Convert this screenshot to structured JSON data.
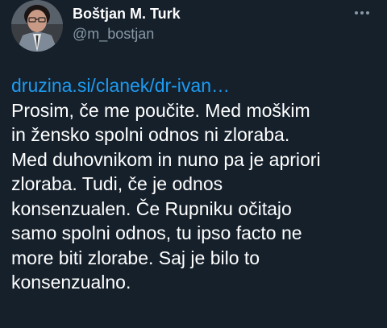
{
  "tweet": {
    "author": {
      "name": "Boštjan M. Turk",
      "handle": "@m_bostjan"
    },
    "link": "druzina.si/clanek/dr-ivan…",
    "text_lines": [
      "Prosim, če me poučite. Med moškim",
      "in žensko spolni odnos ni zloraba.",
      "Med duhovnikom in nuno pa je apriori",
      "zloraba. Tudi, če je odnos",
      "konsenzualen. Če Rupniku očitajo",
      "samo spolni odnos, tu ipso facto ne",
      "more biti zlorabe. Saj je bilo to",
      "konsenzualno."
    ]
  },
  "icons": {
    "more": "more-options-icon",
    "avatar": "profile-photo"
  },
  "colors": {
    "background": "#15202b",
    "text": "#ffffff",
    "secondary": "#8899a6",
    "link": "#1d9bf0"
  }
}
